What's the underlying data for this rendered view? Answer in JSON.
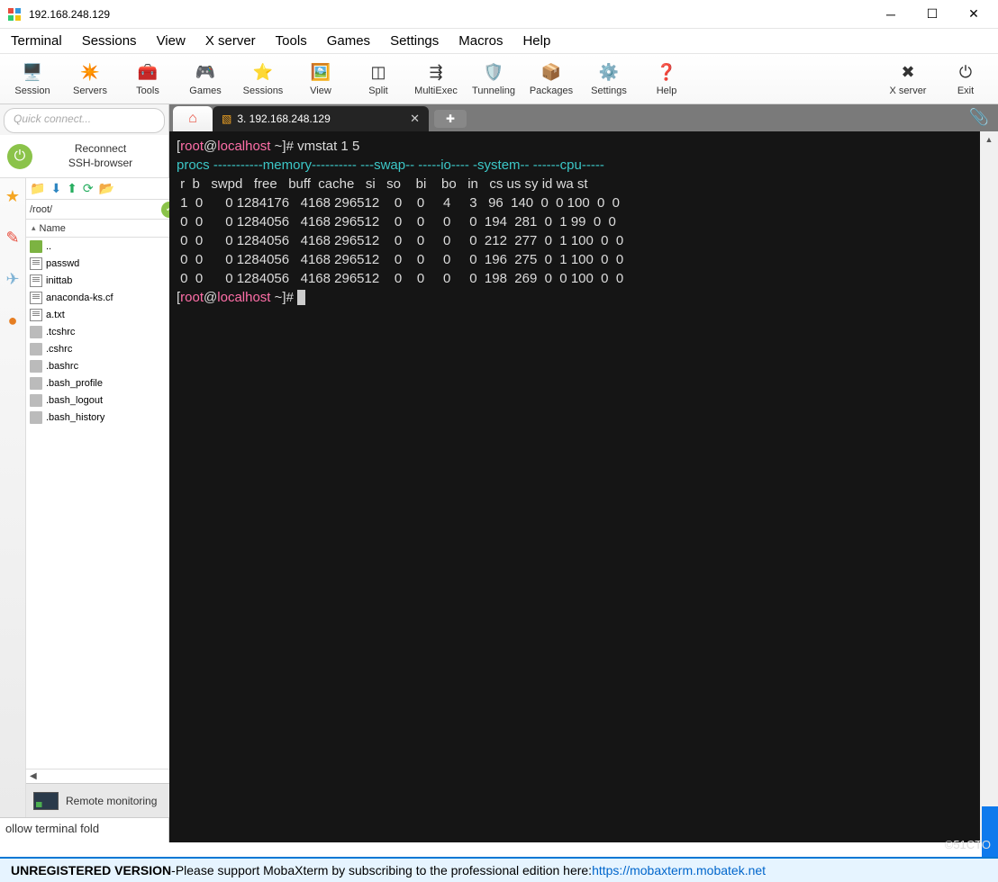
{
  "title": "192.168.248.129",
  "menubar": [
    "Terminal",
    "Sessions",
    "View",
    "X server",
    "Tools",
    "Games",
    "Settings",
    "Macros",
    "Help"
  ],
  "toolbar": [
    {
      "label": "Session",
      "icon": "🖥️"
    },
    {
      "label": "Servers",
      "icon": "✴️"
    },
    {
      "label": "Tools",
      "icon": "🧰"
    },
    {
      "label": "Games",
      "icon": "🎮"
    },
    {
      "label": "Sessions",
      "icon": "⭐"
    },
    {
      "label": "View",
      "icon": "🖼️"
    },
    {
      "label": "Split",
      "icon": "◫"
    },
    {
      "label": "MultiExec",
      "icon": "⇶"
    },
    {
      "label": "Tunneling",
      "icon": "🛡️"
    },
    {
      "label": "Packages",
      "icon": "📦"
    },
    {
      "label": "Settings",
      "icon": "⚙️"
    },
    {
      "label": "Help",
      "icon": "❓"
    }
  ],
  "toolbar_right": [
    {
      "label": "X server",
      "icon": "✖"
    },
    {
      "label": "Exit",
      "icon": "⏻"
    }
  ],
  "quick_connect_placeholder": "Quick connect...",
  "reconnect": {
    "line1": "Reconnect",
    "line2": "SSH-browser"
  },
  "browser": {
    "path": "/root/",
    "header": "Name",
    "files": [
      {
        "name": "..",
        "type": "folder"
      },
      {
        "name": "passwd",
        "type": "txt"
      },
      {
        "name": "inittab",
        "type": "txt"
      },
      {
        "name": "anaconda-ks.cf",
        "type": "txt"
      },
      {
        "name": "a.txt",
        "type": "txt"
      },
      {
        "name": ".tcshrc",
        "type": "generic"
      },
      {
        "name": ".cshrc",
        "type": "generic"
      },
      {
        "name": ".bashrc",
        "type": "generic"
      },
      {
        "name": ".bash_profile",
        "type": "generic"
      },
      {
        "name": ".bash_logout",
        "type": "generic"
      },
      {
        "name": ".bash_history",
        "type": "generic"
      }
    ]
  },
  "remote_mon": "Remote monitoring",
  "terminal_fold": "ollow terminal fold",
  "tabs": {
    "active": "3. 192.168.248.129"
  },
  "terminal": {
    "prompt_user": "root",
    "prompt_at": "@",
    "prompt_host": "localhost",
    "prompt_path": " ~",
    "prompt_end": "]# ",
    "command": "vmstat 1 5",
    "header_line1": "procs -----------memory---------- ---swap-- -----io---- -system-- ------cpu-----",
    "header_line2": " r  b   swpd   free   buff  cache   si   so    bi    bo   in   cs us sy id wa st",
    "rows": [
      " 1  0      0 1284176   4168 296512    0    0     4     3   96  140  0  0 100  0  0",
      " 0  0      0 1284056   4168 296512    0    0     0     0  194  281  0  1 99  0  0",
      " 0  0      0 1284056   4168 296512    0    0     0     0  212  277  0  1 100  0  0",
      " 0  0      0 1284056   4168 296512    0    0     0     0  196  275  0  1 100  0  0",
      " 0  0      0 1284056   4168 296512    0    0     0     0  198  269  0  0 100  0  0"
    ]
  },
  "bottom": {
    "b1": "UNREGISTERED VERSION",
    "sep": "  -  ",
    "b2": "Please support MobaXterm by subscribing to the professional edition here:  ",
    "link": "https://mobaxterm.mobatek.net"
  },
  "watermark": "©51CTO"
}
